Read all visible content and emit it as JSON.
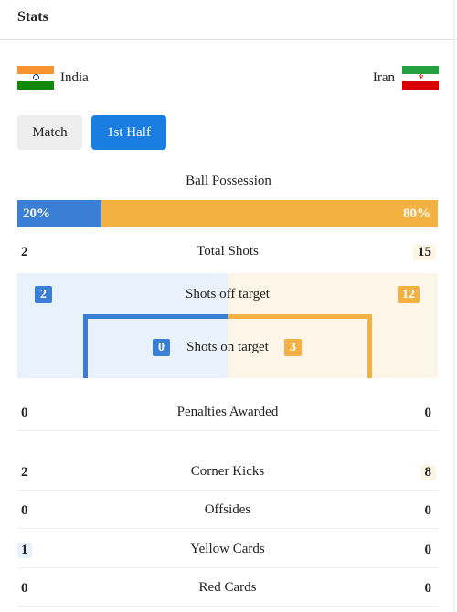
{
  "header": {
    "title": "Stats"
  },
  "teams": {
    "home": {
      "name": "India",
      "flag_colors": [
        "#f7932f",
        "#ffffff",
        "#128807"
      ],
      "chakra_color": "#0a2b7a"
    },
    "away": {
      "name": "Iran",
      "flag_colors": [
        "#239f40",
        "#ffffff",
        "#da0000"
      ]
    }
  },
  "tabs": [
    {
      "label": "Match",
      "active": false
    },
    {
      "label": "1st Half",
      "active": true
    }
  ],
  "possession": {
    "label": "Ball Possession",
    "home": "20%",
    "away": "80%",
    "home_fraction": 0.2
  },
  "total_shots": {
    "label": "Total Shots",
    "home": "2",
    "away": "15"
  },
  "shots_off_target": {
    "label": "Shots off target",
    "home": "2",
    "away": "12"
  },
  "shots_on_target": {
    "label": "Shots on target",
    "home": "0",
    "away": "3"
  },
  "stats": [
    {
      "label": "Penalties Awarded",
      "home": "0",
      "away": "0"
    },
    {
      "label": "Corner Kicks",
      "home": "2",
      "away": "8"
    },
    {
      "label": "Offsides",
      "home": "0",
      "away": "0"
    },
    {
      "label": "Yellow Cards",
      "home": "1",
      "away": "0"
    },
    {
      "label": "Red Cards",
      "home": "0",
      "away": "0"
    }
  ],
  "colors": {
    "home": "#3a7fd5",
    "away": "#f2b140",
    "active_tab": "#1a7ee0"
  }
}
